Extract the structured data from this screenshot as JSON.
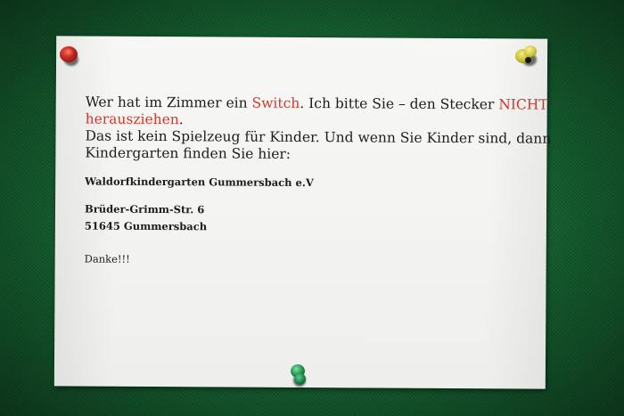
{
  "note": {
    "line1": {
      "part1": "Wer hat im Zimmer  ein ",
      "switch": "Switch",
      "part2": ". Ich bitte Sie – den Stecker ",
      "nicht": "NICHT"
    },
    "line2": {
      "herausziehen": "herausziehen",
      "period": "."
    },
    "line3": "Das ist kein Spielzeug für Kinder. Und wenn Sie Kinder sind, dann",
    "line4": "Kindergarten finden Sie hier:",
    "organization": "Waldorfkindergarten Gummersbach e.V",
    "address": {
      "street": "Brüder-Grimm-Str. 6",
      "city": "51645 Gummersbach"
    },
    "thanks": "Danke!!!"
  },
  "colors": {
    "board": "#0f5a2a",
    "paper": "#f4f4f2",
    "text": "#1c1c1c",
    "highlight_red": "#d4372a",
    "pin_red": "#b5221f",
    "pin_yellow": "#c9c23a",
    "pin_green": "#1e8a4a"
  },
  "pins": [
    {
      "name": "pin-red",
      "color": "red"
    },
    {
      "name": "pin-yellow",
      "color": "yellow"
    },
    {
      "name": "pin-green",
      "color": "green"
    }
  ]
}
